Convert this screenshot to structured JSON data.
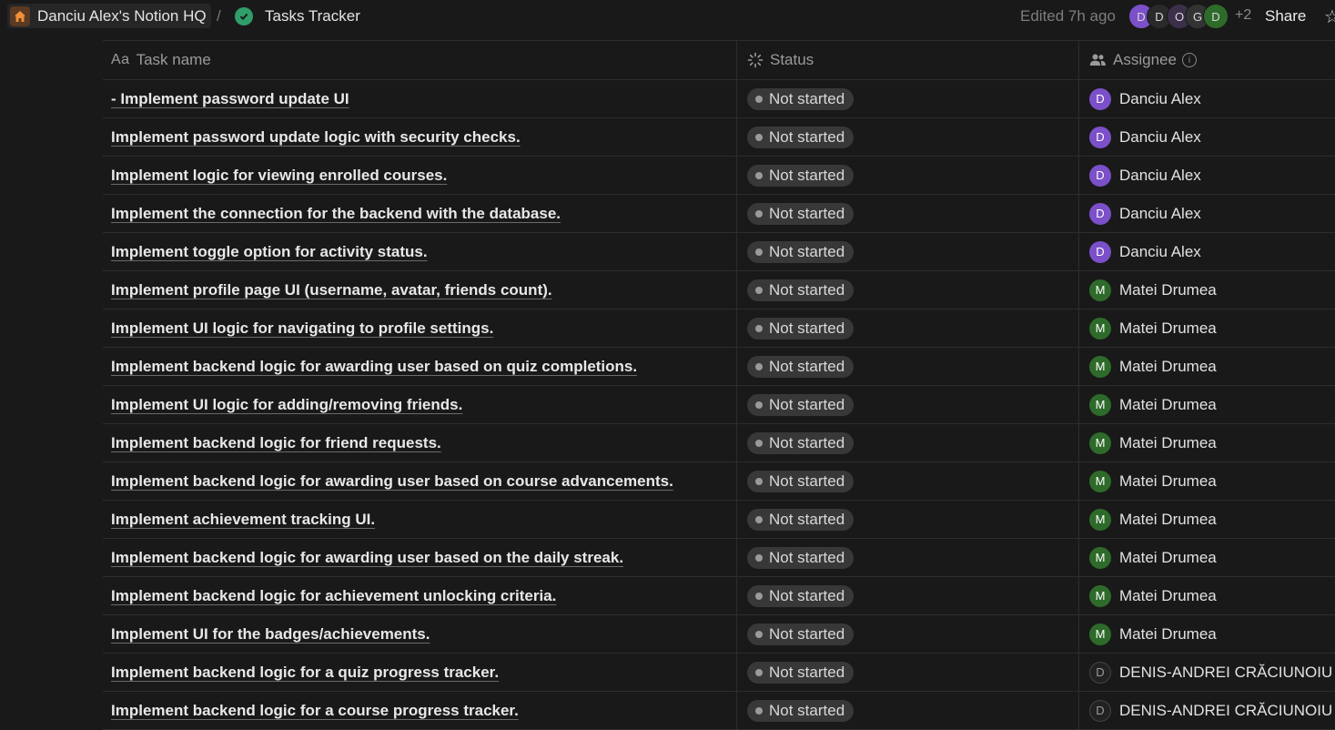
{
  "breadcrumb": {
    "workspace": "Danciu Alex's Notion HQ",
    "separator": "/",
    "page": "Tasks Tracker"
  },
  "header": {
    "edited": "Edited 7h ago",
    "extra_count": "+2",
    "share_label": "Share",
    "avatars": [
      {
        "initial": "D",
        "color": "#7b50c9"
      },
      {
        "initial": "D",
        "color": "#2a2a2a"
      },
      {
        "initial": "O",
        "color": "#3b2f4a"
      },
      {
        "initial": "G",
        "color": "#333333"
      },
      {
        "initial": "D",
        "color": "#2e6b2a"
      }
    ]
  },
  "columns": {
    "task": "Task name",
    "status": "Status",
    "assignee": "Assignee"
  },
  "rows": [
    {
      "task": "- Implement password update UI",
      "status": "Not started",
      "assignee": "Danciu Alex",
      "initial": "D",
      "color": "purple"
    },
    {
      "task": "Implement password update logic with security checks.",
      "status": "Not started",
      "assignee": "Danciu Alex",
      "initial": "D",
      "color": "purple"
    },
    {
      "task": "Implement logic for viewing enrolled courses.",
      "status": "Not started",
      "assignee": "Danciu Alex",
      "initial": "D",
      "color": "purple"
    },
    {
      "task": "Implement the connection for the backend with the database.",
      "status": "Not started",
      "assignee": "Danciu Alex",
      "initial": "D",
      "color": "purple"
    },
    {
      "task": "Implement toggle option for activity status.",
      "status": "Not started",
      "assignee": "Danciu Alex",
      "initial": "D",
      "color": "purple"
    },
    {
      "task": "Implement profile page UI (username, avatar, friends count).",
      "status": "Not started",
      "assignee": "Matei Drumea",
      "initial": "M",
      "color": "green"
    },
    {
      "task": "Implement UI logic for navigating to profile settings.",
      "status": "Not started",
      "assignee": "Matei Drumea",
      "initial": "M",
      "color": "green"
    },
    {
      "task": "Implement backend logic for awarding user based on quiz completions.",
      "status": "Not started",
      "assignee": "Matei Drumea",
      "initial": "M",
      "color": "green"
    },
    {
      "task": "Implement UI logic for adding/removing friends.",
      "status": "Not started",
      "assignee": "Matei Drumea",
      "initial": "M",
      "color": "green"
    },
    {
      "task": "Implement backend logic for friend requests.",
      "status": "Not started",
      "assignee": "Matei Drumea",
      "initial": "M",
      "color": "green"
    },
    {
      "task": "Implement backend logic for awarding user based on course advancements.",
      "status": "Not started",
      "assignee": "Matei Drumea",
      "initial": "M",
      "color": "green"
    },
    {
      "task": "Implement achievement tracking UI.",
      "status": "Not started",
      "assignee": "Matei Drumea",
      "initial": "M",
      "color": "green"
    },
    {
      "task": "Implement backend logic for awarding user based on the daily streak.",
      "status": "Not started",
      "assignee": "Matei Drumea",
      "initial": "M",
      "color": "green"
    },
    {
      "task": "Implement backend logic for achievement unlocking criteria.",
      "status": "Not started",
      "assignee": "Matei Drumea",
      "initial": "M",
      "color": "green"
    },
    {
      "task": "Implement UI for the badges/achievements.",
      "status": "Not started",
      "assignee": "Matei Drumea",
      "initial": "M",
      "color": "green"
    },
    {
      "task": "Implement backend logic for a quiz progress tracker.",
      "status": "Not started",
      "assignee": "DENIS-ANDREI CRĂCIUNOIU",
      "initial": "D",
      "color": "dark"
    },
    {
      "task": "Implement backend logic for a course progress tracker.",
      "status": "Not started",
      "assignee": "DENIS-ANDREI CRĂCIUNOIU",
      "initial": "D",
      "color": "dark"
    }
  ]
}
